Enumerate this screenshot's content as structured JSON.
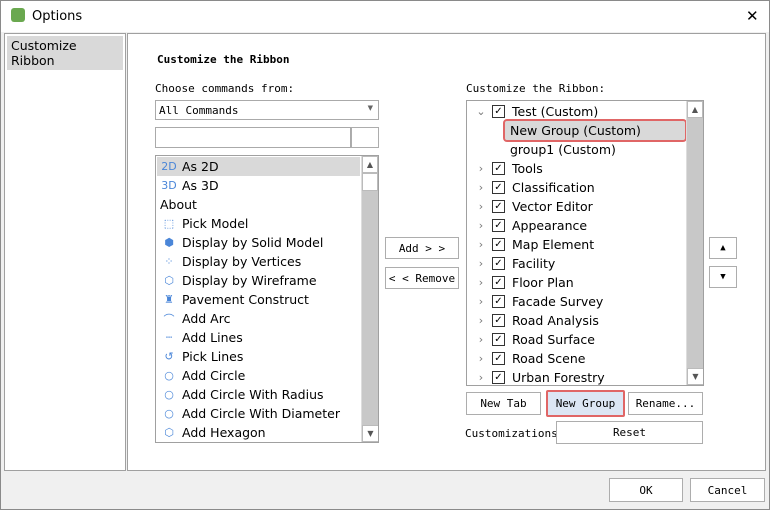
{
  "window": {
    "title": "Options",
    "close": "✕"
  },
  "sidebar": {
    "items": [
      {
        "label": "Customize Ribbon"
      }
    ]
  },
  "main": {
    "heading": "Customize the Ribbon",
    "left": {
      "label": "Choose commands from:",
      "dropdown_value": "All Commands",
      "search_value": "",
      "commands": [
        {
          "icon": "2D",
          "label": "As 2D"
        },
        {
          "icon": "3D",
          "label": "As 3D"
        },
        {
          "icon": "",
          "label": "About"
        },
        {
          "icon": "⬚",
          "label": "Pick Model"
        },
        {
          "icon": "⬢",
          "label": "Display by Solid Model"
        },
        {
          "icon": "⁘",
          "label": "Display by Vertices"
        },
        {
          "icon": "⬡",
          "label": "Display by Wireframe"
        },
        {
          "icon": "♜",
          "label": "Pavement Construct"
        },
        {
          "icon": "⌒",
          "label": "Add Arc"
        },
        {
          "icon": "┄",
          "label": "Add Lines"
        },
        {
          "icon": "↺",
          "label": "Pick Lines"
        },
        {
          "icon": "○",
          "label": "Add Circle"
        },
        {
          "icon": "○",
          "label": "Add Circle With Radius"
        },
        {
          "icon": "○",
          "label": "Add Circle With Diameter"
        },
        {
          "icon": "⬡",
          "label": "Add Hexagon"
        }
      ]
    },
    "add_label": "Add > >",
    "remove_label": "< < Remove",
    "right": {
      "label": "Customize the Ribbon:",
      "tree": [
        {
          "label": "Test (Custom)",
          "level": 0,
          "expanded": true,
          "checked": true
        },
        {
          "label": "New Group (Custom)",
          "level": 1,
          "selected": true
        },
        {
          "label": "group1 (Custom)",
          "level": 1
        },
        {
          "label": "Tools",
          "level": 0,
          "checked": true
        },
        {
          "label": "Classification",
          "level": 0,
          "checked": true
        },
        {
          "label": "Vector Editor",
          "level": 0,
          "checked": true
        },
        {
          "label": "Appearance",
          "level": 0,
          "checked": true
        },
        {
          "label": "Map Element",
          "level": 0,
          "checked": true
        },
        {
          "label": "Facility",
          "level": 0,
          "checked": true
        },
        {
          "label": "Floor Plan",
          "level": 0,
          "checked": true
        },
        {
          "label": "Facade Survey",
          "level": 0,
          "checked": true
        },
        {
          "label": "Road Analysis",
          "level": 0,
          "checked": true
        },
        {
          "label": "Road Surface",
          "level": 0,
          "checked": true
        },
        {
          "label": "Road Scene",
          "level": 0,
          "checked": true
        },
        {
          "label": "Urban Forestry",
          "level": 0,
          "checked": true
        }
      ],
      "new_tab": "New Tab",
      "new_group": "New Group",
      "rename": "Rename...",
      "customizations_label": "Customizations:",
      "reset": "Reset"
    }
  },
  "footer": {
    "ok": "OK",
    "cancel": "Cancel"
  },
  "colors": {
    "highlight": "#e06666",
    "selected_row": "#d9d9d9",
    "new_group_bg": "#dce6f4"
  }
}
